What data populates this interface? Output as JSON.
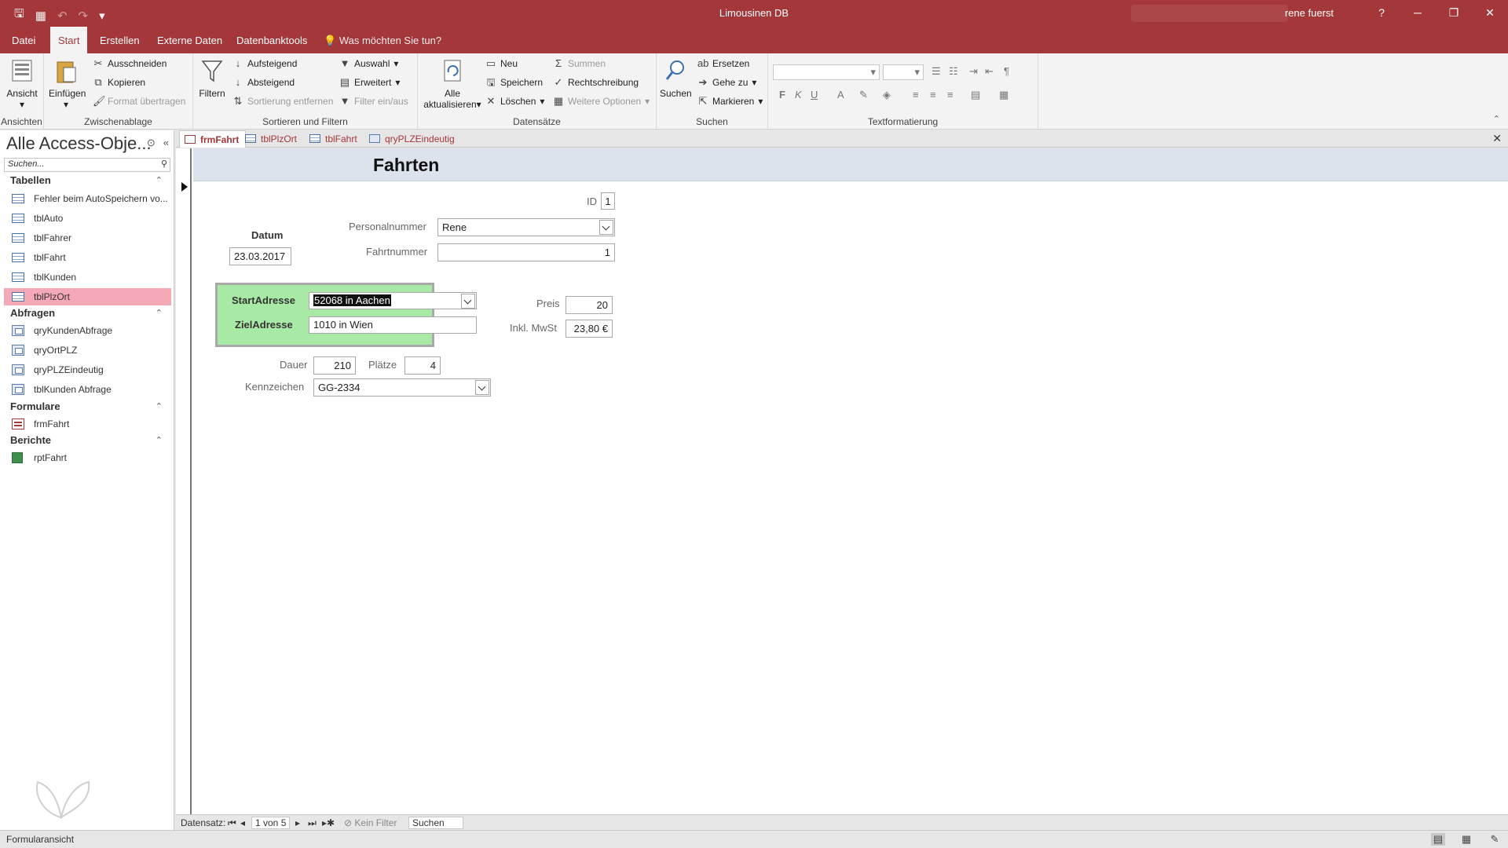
{
  "titlebar": {
    "title": "Limousinen DB",
    "user": "rene fuerst",
    "help": "?",
    "minimize": "─",
    "restore": "❐",
    "close": "✕"
  },
  "tabs": {
    "items": [
      "Datei",
      "Start",
      "Erstellen",
      "Externe Daten",
      "Datenbanktools"
    ],
    "active": "Start",
    "tell_me": "Was möchten Sie tun?"
  },
  "ribbon": {
    "ansichten": {
      "label": "Ansichten",
      "ansicht": "Ansicht"
    },
    "zwischenablage": {
      "label": "Zwischenablage",
      "einfuegen": "Einfügen",
      "ausschneiden": "Ausschneiden",
      "kopieren": "Kopieren",
      "format": "Format übertragen"
    },
    "sortieren": {
      "label": "Sortieren und Filtern",
      "filtern": "Filtern",
      "aufsteigend": "Aufsteigend",
      "absteigend": "Absteigend",
      "sortierung_entfernen": "Sortierung entfernen",
      "auswahl": "Auswahl",
      "erweitert": "Erweitert",
      "filter_einaus": "Filter ein/aus"
    },
    "datensaetze": {
      "label": "Datensätze",
      "alle_aktualisieren": "Alle aktualisieren",
      "neu": "Neu",
      "speichern": "Speichern",
      "loeschen": "Löschen",
      "summen": "Summen",
      "rechtschreibung": "Rechtschreibung",
      "weitere": "Weitere Optionen"
    },
    "suchen": {
      "label": "Suchen",
      "suchen": "Suchen",
      "ersetzen": "Ersetzen",
      "gehe_zu": "Gehe zu",
      "markieren": "Markieren"
    },
    "textformatierung": {
      "label": "Textformatierung",
      "bold": "F",
      "italic": "K",
      "underline": "U"
    }
  },
  "nav": {
    "title": "Alle Access-Obje...",
    "search_placeholder": "Suchen...",
    "sections": [
      {
        "name": "Tabellen",
        "items": [
          "Fehler beim AutoSpeichern vo...",
          "tblAuto",
          "tblFahrer",
          "tblFahrt",
          "tblKunden",
          "tblPlzOrt"
        ]
      },
      {
        "name": "Abfragen",
        "items": [
          "qryKundenAbfrage",
          "qryOrtPLZ",
          "qryPLZEindeutig",
          "tblKunden Abfrage"
        ]
      },
      {
        "name": "Formulare",
        "items": [
          "frmFahrt"
        ]
      },
      {
        "name": "Berichte",
        "items": [
          "rptFahrt"
        ]
      }
    ],
    "selected": "tblPlzOrt"
  },
  "doctabs": [
    "frmFahrt",
    "tblPlzOrt",
    "tblFahrt",
    "qryPLZEindeutig"
  ],
  "form": {
    "title": "Fahrten",
    "id_label": "ID",
    "id_value": "1",
    "datum_label": "Datum",
    "datum_value": "23.03.2017",
    "personalnummer_label": "Personalnummer",
    "personalnummer_value": "Rene",
    "fahrtnummer_label": "Fahrtnummer",
    "fahrtnummer_value": "1",
    "startadresse_label": "StartAdresse",
    "startadresse_value": "52068 in Aachen",
    "zieladresse_label": "ZielAdresse",
    "zieladresse_value": "1010 in Wien",
    "preis_label": "Preis",
    "preis_value": "20",
    "mwst_label": "Inkl. MwSt",
    "mwst_value": "23,80 €",
    "dauer_label": "Dauer",
    "dauer_value": "210",
    "plaetze_label": "Plätze",
    "plaetze_value": "4",
    "kennzeichen_label": "Kennzeichen",
    "kennzeichen_value": "GG-2334"
  },
  "recnav": {
    "label": "Datensatz:",
    "position": "1 von 5",
    "filter": "Kein Filter",
    "search": "Suchen"
  },
  "status": {
    "text": "Formularansicht"
  }
}
